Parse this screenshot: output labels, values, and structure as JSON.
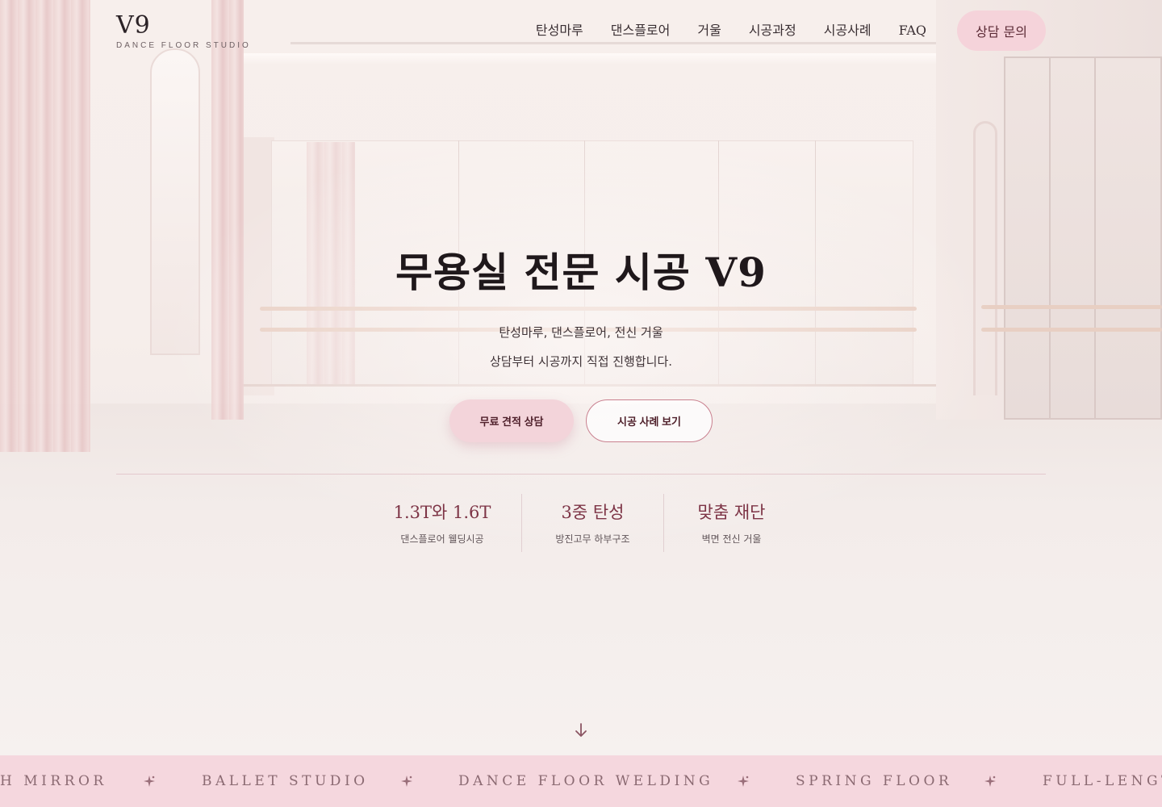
{
  "brand": {
    "name": "V9",
    "tagline": "DANCE FLOOR STUDIO"
  },
  "nav": {
    "items": [
      "탄성마루",
      "댄스플로어",
      "거울",
      "시공과정",
      "시공사례",
      "FAQ"
    ],
    "cta_label": "상담 문의"
  },
  "hero": {
    "title": "무용실 전문 시공 V9",
    "subtitle_line1": "탄성마루, 댄스플로어, 전신 거울",
    "subtitle_line2": "상담부터 시공까지 직접 진행합니다.",
    "primary_button": "무료 견적 상담",
    "secondary_button": "시공 사례 보기"
  },
  "stats": [
    {
      "value": "1.3T와 1.6T",
      "label": "댄스플로어 웰딩시공"
    },
    {
      "value": "3중 탄성",
      "label": "방진고무 하부구조"
    },
    {
      "value": "맞춤 재단",
      "label": "벽면 전신 거울"
    }
  ],
  "scroll_icon": "arrow-down-icon",
  "marquee": {
    "items": [
      "H MIRROR",
      "BALLET STUDIO",
      "DANCE FLOOR WELDING",
      "SPRING FLOOR",
      "FULL-LENGT"
    ],
    "separator_icon": "sparkle-icon"
  },
  "colors": {
    "accent_pink": "#f5d3da",
    "accent_text": "#7d3446",
    "marquee_bg": "#f5d7de",
    "outline_border": "#c9808f"
  }
}
